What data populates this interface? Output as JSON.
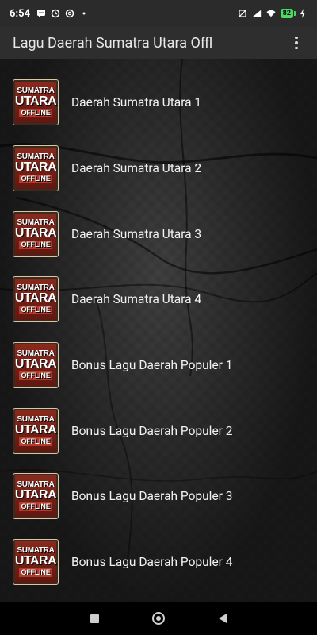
{
  "status": {
    "time": "6:54",
    "battery": "82",
    "left_icons": [
      "chat-icon",
      "sync-icon",
      "at-icon",
      "dot-icon"
    ],
    "right_icons": [
      "mute-icon",
      "signal-icon",
      "wifi-icon",
      "battery-icon",
      "charging-icon"
    ]
  },
  "app_bar": {
    "title": "Lagu Daerah Sumatra Utara Offl",
    "menu_icon": "overflow-menu-icon"
  },
  "thumbnail": {
    "line1": "SUMATRA",
    "line2": "UTARA",
    "line3": "OFFLINE"
  },
  "items": [
    {
      "label": "Daerah Sumatra Utara 1"
    },
    {
      "label": "Daerah Sumatra Utara 2"
    },
    {
      "label": "Daerah Sumatra Utara 3"
    },
    {
      "label": "Daerah Sumatra Utara 4"
    },
    {
      "label": "Bonus Lagu Daerah Populer 1"
    },
    {
      "label": "Bonus Lagu Daerah Populer 2"
    },
    {
      "label": "Bonus Lagu Daerah Populer 3"
    },
    {
      "label": "Bonus Lagu Daerah Populer 4"
    }
  ],
  "nav": {
    "recents": "recents-icon",
    "home": "home-icon",
    "back": "back-icon"
  },
  "colors": {
    "status_bar": "#2b2b2b",
    "app_bar": "#2e2e2e",
    "thumb_red": "#8a2a1d",
    "battery_green": "#4cd964"
  }
}
